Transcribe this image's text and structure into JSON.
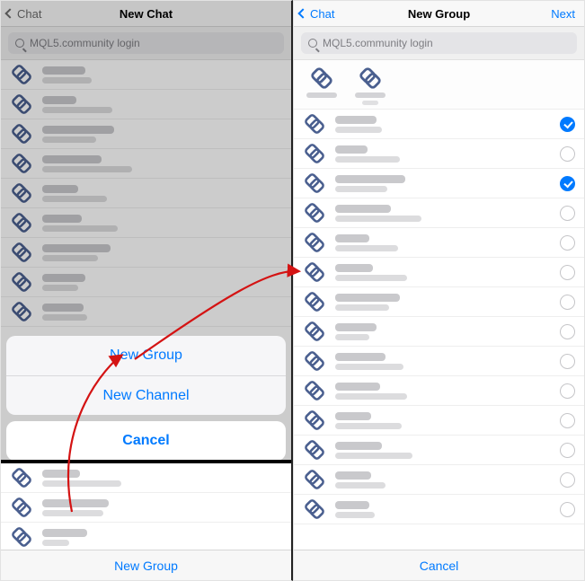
{
  "left": {
    "nav": {
      "back": "Chat",
      "title": "New Chat"
    },
    "search_placeholder": "MQL5.community login",
    "sheet": {
      "option1": "New Group",
      "option2": "New Channel",
      "cancel": "Cancel"
    },
    "bottom_label": "New Group",
    "rows": [
      {
        "w1": 48,
        "w2": 55
      },
      {
        "w1": 38,
        "w2": 78
      },
      {
        "w1": 80,
        "w2": 60
      },
      {
        "w1": 66,
        "w2": 100
      },
      {
        "w1": 40,
        "w2": 72
      },
      {
        "w1": 44,
        "w2": 84
      },
      {
        "w1": 76,
        "w2": 62
      },
      {
        "w1": 48,
        "w2": 40
      },
      {
        "w1": 46,
        "w2": 50
      }
    ],
    "rows_below": [
      {
        "w1": 42,
        "w2": 88
      },
      {
        "w1": 74,
        "w2": 68
      },
      {
        "w1": 50,
        "w2": 30
      }
    ]
  },
  "right": {
    "nav": {
      "back": "Chat",
      "title": "New Group",
      "next": "Next"
    },
    "search_placeholder": "MQL5.community login",
    "bottom_label": "Cancel",
    "rows": [
      {
        "w1": 46,
        "w2": 52,
        "checked": true
      },
      {
        "w1": 36,
        "w2": 72,
        "checked": false
      },
      {
        "w1": 78,
        "w2": 58,
        "checked": true
      },
      {
        "w1": 62,
        "w2": 96,
        "checked": false
      },
      {
        "w1": 38,
        "w2": 70,
        "checked": false
      },
      {
        "w1": 42,
        "w2": 80,
        "checked": false
      },
      {
        "w1": 72,
        "w2": 60,
        "checked": false
      },
      {
        "w1": 46,
        "w2": 38,
        "checked": false
      },
      {
        "w1": 56,
        "w2": 76,
        "checked": false
      },
      {
        "w1": 50,
        "w2": 80,
        "checked": false
      },
      {
        "w1": 40,
        "w2": 74,
        "checked": false
      },
      {
        "w1": 52,
        "w2": 86,
        "checked": false
      },
      {
        "w1": 40,
        "w2": 56,
        "checked": false
      },
      {
        "w1": 38,
        "w2": 44,
        "checked": false
      }
    ]
  },
  "chart_data": null
}
